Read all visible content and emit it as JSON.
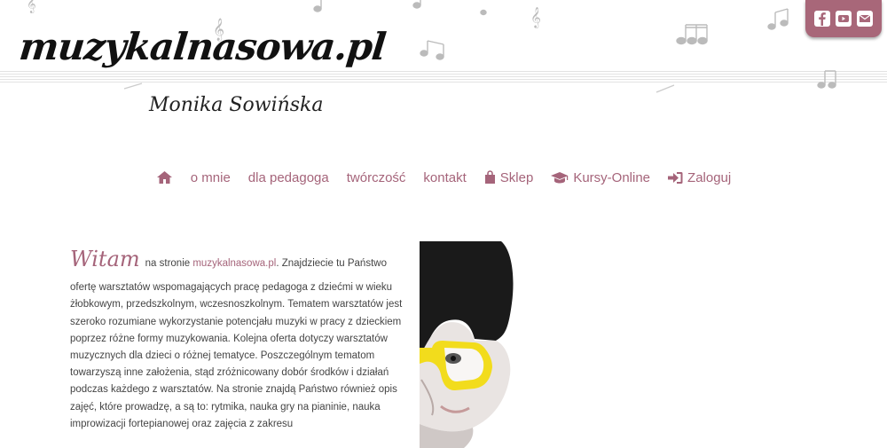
{
  "header": {
    "logo": "muzykalnasowa.pl",
    "subtitle": "Monika Sowińska"
  },
  "social": [
    {
      "icon": "facebook-icon"
    },
    {
      "icon": "youtube-icon"
    },
    {
      "icon": "envelope-icon"
    }
  ],
  "nav": {
    "home_icon": "home-icon",
    "items": [
      {
        "label": "o mnie"
      },
      {
        "label": "dla pedagoga"
      },
      {
        "label": "twórczość"
      },
      {
        "label": "kontakt"
      },
      {
        "label": "Sklep",
        "icon": "shopping-bag-icon"
      },
      {
        "label": "Kursy-Online",
        "icon": "graduation-cap-icon"
      },
      {
        "label": "Zaloguj",
        "icon": "sign-in-icon"
      }
    ]
  },
  "main": {
    "greeting": "Witam",
    "intro_prefix": "na stronie ",
    "intro_link": "muzykalnasowa.pl",
    "intro_suffix": ". Znajdziecie tu Państwo",
    "body": "ofertę warsztatów wspomagających pracę pedagoga z dziećmi w wieku żłobkowym, przedszkolnym, wczesnoszkolnym. Tematem warsztatów jest szeroko rozumiane wykorzystanie potencjału muzyki w pracy z dzieckiem poprzez różne formy muzykowania. Kolejna oferta dotyczy warsztatów muzycznych dla dzieci o różnej tematyce. Poszczególnym tematom towarzyszą inne założenia, stąd zróżnicowany dobór środków i działań podczas każdego z warsztatów. Na stronie znajdą Państwo również opis zajęć, które prowadzę, a są to: rytmika, nauka gry na pianinie, nauka improwizacji fortepianowej oraz zajęcia z zakresu"
  },
  "colors": {
    "accent": "#a5647a",
    "social_bg": "#a86779",
    "glasses": "#f2dc1c"
  }
}
